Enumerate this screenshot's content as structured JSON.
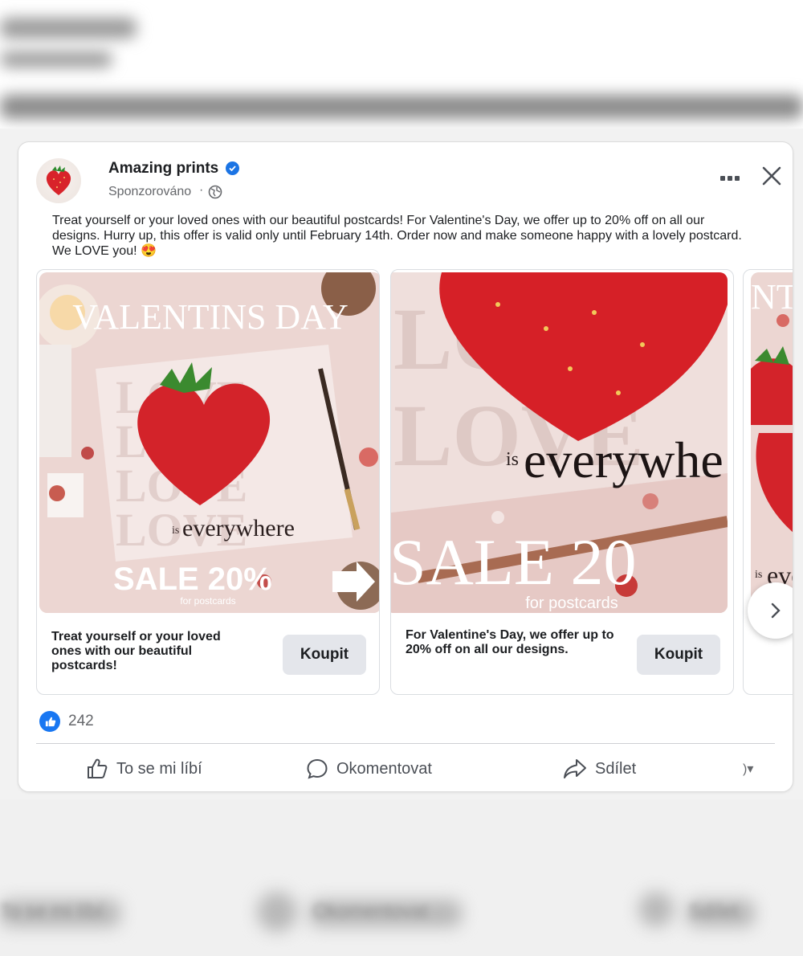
{
  "post": {
    "page_name": "Amazing prints",
    "sponsored_label": "Sponzorováno",
    "separator": "·",
    "text": "Treat yourself or your loved ones with our beautiful postcards! For Valentine's Day, we offer up to 20% off on all our designs. Hurry up, this offer is valid only until February 14th. Order now and make someone happy with a lovely postcard. We LOVE you! 😍"
  },
  "carousel": {
    "cards": [
      {
        "image_title": "VALENTINS DAY",
        "image_love": "LOVE",
        "image_is": "is",
        "image_everywhere": "everywhere",
        "image_sale": "SALE 20%",
        "image_sub": "for postcards",
        "caption": "Treat yourself or your loved ones with our beautiful postcards!",
        "button": "Koupit"
      },
      {
        "image_love": "LOVE",
        "image_is": "is",
        "image_everywhere": "everywhe",
        "image_sale": "SALE 20",
        "image_sub": "for postcards",
        "caption": "For Valentine's Day, we offer up to 20% off on all our designs.",
        "button": "Koupit"
      },
      {
        "image_title": "NT",
        "image_is": "is",
        "image_everywhere": "eve"
      }
    ]
  },
  "reactions": {
    "count": "242"
  },
  "actions": {
    "like": "To se mi líbí",
    "comment": "Okomentovat",
    "share": "Sdílet",
    "profile_switch": ")▾"
  },
  "background": {
    "bottom_buttons": [
      "To se mi líbí",
      "Okomentovat",
      "Sdílet"
    ]
  },
  "colors": {
    "brand_blue": "#1877f2",
    "verified_blue": "#1b74e4",
    "button_gray": "#e4e6eb",
    "strawberry_red": "#d8232a"
  },
  "icons": [
    "strawberry-heart-avatar",
    "verified-badge-icon",
    "globe-icon",
    "more-icon",
    "close-icon",
    "chevron-right-icon",
    "like-reaction-icon",
    "thumbs-up-icon",
    "comment-icon",
    "share-icon"
  ]
}
